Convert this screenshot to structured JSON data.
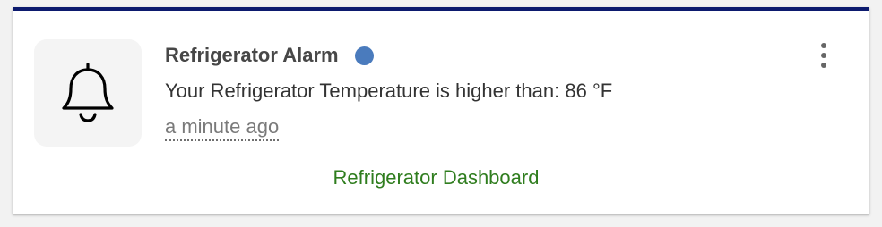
{
  "notification": {
    "title": "Refrigerator Alarm",
    "message": "Your Refrigerator Temperature is higher than: 86 °F",
    "timestamp": "a minute ago",
    "link_label": "Refrigerator Dashboard",
    "icon": "bell-icon",
    "unread": true,
    "colors": {
      "accent_bar": "#0c1a6e",
      "unread_dot": "#4a7bbd",
      "link": "#2f7d1e"
    }
  },
  "menu": {
    "icon": "more-vertical-icon"
  }
}
